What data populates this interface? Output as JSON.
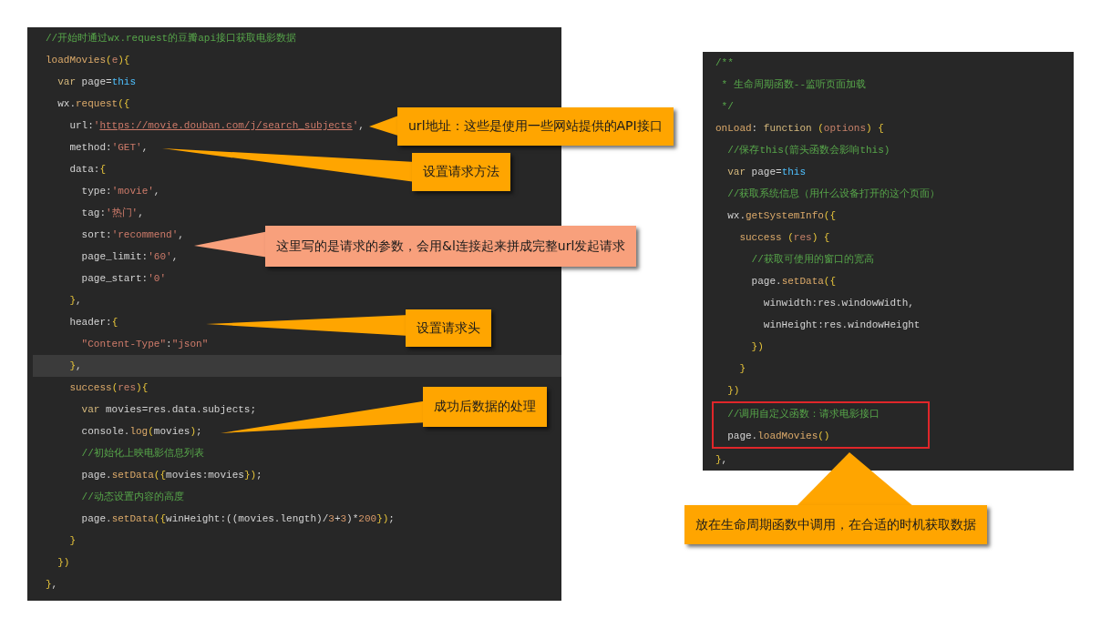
{
  "left_editor": {
    "lines": [
      {
        "current": false,
        "tokens": [
          {
            "kind": "comment",
            "text": "//开始时通过wx.request的豆瓣api接口获取电影数据"
          }
        ]
      },
      {
        "current": false,
        "tokens": [
          {
            "kind": "func",
            "text": "loadMovies"
          },
          {
            "kind": "bracket",
            "text": "("
          },
          {
            "kind": "param",
            "text": "e"
          },
          {
            "kind": "bracket",
            "text": "){"
          }
        ]
      },
      {
        "current": false,
        "tokens": [
          {
            "kind": "keyword",
            "text": "  var"
          },
          {
            "kind": "plain",
            "text": " page="
          },
          {
            "kind": "this",
            "text": "this"
          }
        ]
      },
      {
        "current": false,
        "tokens": [
          {
            "kind": "plain",
            "text": "  wx."
          },
          {
            "kind": "func",
            "text": "request"
          },
          {
            "kind": "bracket",
            "text": "({"
          }
        ]
      },
      {
        "current": false,
        "tokens": [
          {
            "kind": "plain",
            "text": "    url:"
          },
          {
            "kind": "string",
            "text": "'"
          },
          {
            "kind": "url",
            "text": "https://movie.douban.com/j/search_subjects"
          },
          {
            "kind": "string",
            "text": "'"
          },
          {
            "kind": "plain",
            "text": ","
          }
        ]
      },
      {
        "current": false,
        "tokens": [
          {
            "kind": "plain",
            "text": "    method:"
          },
          {
            "kind": "string",
            "text": "'GET'"
          },
          {
            "kind": "plain",
            "text": ","
          }
        ]
      },
      {
        "current": false,
        "tokens": [
          {
            "kind": "plain",
            "text": "    data:"
          },
          {
            "kind": "bracket",
            "text": "{"
          }
        ]
      },
      {
        "current": false,
        "tokens": [
          {
            "kind": "plain",
            "text": "      type:"
          },
          {
            "kind": "string",
            "text": "'movie'"
          },
          {
            "kind": "plain",
            "text": ","
          }
        ]
      },
      {
        "current": false,
        "tokens": [
          {
            "kind": "plain",
            "text": "      tag:"
          },
          {
            "kind": "string",
            "text": "'热门'"
          },
          {
            "kind": "plain",
            "text": ","
          }
        ]
      },
      {
        "current": false,
        "tokens": [
          {
            "kind": "plain",
            "text": "      sort:"
          },
          {
            "kind": "string",
            "text": "'recommend'"
          },
          {
            "kind": "plain",
            "text": ","
          }
        ]
      },
      {
        "current": false,
        "tokens": [
          {
            "kind": "plain",
            "text": "      page_limit:"
          },
          {
            "kind": "string",
            "text": "'60'"
          },
          {
            "kind": "plain",
            "text": ","
          }
        ]
      },
      {
        "current": false,
        "tokens": [
          {
            "kind": "plain",
            "text": "      page_start:"
          },
          {
            "kind": "string",
            "text": "'0'"
          }
        ]
      },
      {
        "current": false,
        "tokens": [
          {
            "kind": "bracket",
            "text": "    }"
          },
          {
            "kind": "plain",
            "text": ","
          }
        ]
      },
      {
        "current": false,
        "tokens": [
          {
            "kind": "plain",
            "text": "    header:"
          },
          {
            "kind": "bracket",
            "text": "{"
          }
        ]
      },
      {
        "current": false,
        "tokens": [
          {
            "kind": "string",
            "text": "      \"Content-Type\""
          },
          {
            "kind": "plain",
            "text": ":"
          },
          {
            "kind": "string",
            "text": "\"json\""
          }
        ]
      },
      {
        "current": true,
        "tokens": [
          {
            "kind": "bracket",
            "text": "    }"
          },
          {
            "kind": "plain",
            "text": ","
          }
        ]
      },
      {
        "current": false,
        "tokens": [
          {
            "kind": "func",
            "text": "    success"
          },
          {
            "kind": "bracket",
            "text": "("
          },
          {
            "kind": "param",
            "text": "res"
          },
          {
            "kind": "bracket",
            "text": "){"
          }
        ]
      },
      {
        "current": false,
        "tokens": [
          {
            "kind": "keyword",
            "text": "      var"
          },
          {
            "kind": "plain",
            "text": " movies=res.data.subjects;"
          }
        ]
      },
      {
        "current": false,
        "tokens": [
          {
            "kind": "plain",
            "text": "      console."
          },
          {
            "kind": "func",
            "text": "log"
          },
          {
            "kind": "bracket",
            "text": "("
          },
          {
            "kind": "plain",
            "text": "movies"
          },
          {
            "kind": "bracket",
            "text": ")"
          },
          {
            "kind": "plain",
            "text": ";"
          }
        ]
      },
      {
        "current": false,
        "tokens": [
          {
            "kind": "comment",
            "text": "      //初始化上映电影信息列表"
          }
        ]
      },
      {
        "current": false,
        "tokens": [
          {
            "kind": "plain",
            "text": "      page."
          },
          {
            "kind": "func",
            "text": "setData"
          },
          {
            "kind": "bracket",
            "text": "({"
          },
          {
            "kind": "plain",
            "text": "movies:movies"
          },
          {
            "kind": "bracket",
            "text": "})"
          },
          {
            "kind": "plain",
            "text": ";"
          }
        ]
      },
      {
        "current": false,
        "tokens": [
          {
            "kind": "comment",
            "text": "      //动态设置内容的高度"
          }
        ]
      },
      {
        "current": false,
        "tokens": [
          {
            "kind": "plain",
            "text": "      page."
          },
          {
            "kind": "func",
            "text": "setData"
          },
          {
            "kind": "bracket",
            "text": "({"
          },
          {
            "kind": "plain",
            "text": "winHeight:((movies.length)/"
          },
          {
            "kind": "number",
            "text": "3"
          },
          {
            "kind": "plain",
            "text": "+"
          },
          {
            "kind": "number",
            "text": "3"
          },
          {
            "kind": "plain",
            "text": ")*"
          },
          {
            "kind": "number",
            "text": "200"
          },
          {
            "kind": "bracket",
            "text": "})"
          },
          {
            "kind": "plain",
            "text": ";"
          }
        ]
      },
      {
        "current": false,
        "tokens": [
          {
            "kind": "bracket",
            "text": "    }"
          }
        ]
      },
      {
        "current": false,
        "tokens": [
          {
            "kind": "bracket",
            "text": "  })"
          }
        ]
      },
      {
        "current": false,
        "tokens": [
          {
            "kind": "bracket",
            "text": "}"
          },
          {
            "kind": "plain",
            "text": ","
          }
        ]
      }
    ]
  },
  "right_editor": {
    "lines_before": [
      {
        "tokens": [
          {
            "kind": "comment",
            "text": "/**"
          }
        ]
      },
      {
        "tokens": [
          {
            "kind": "comment",
            "text": " * 生命周期函数--监听页面加载"
          }
        ]
      },
      {
        "tokens": [
          {
            "kind": "comment",
            "text": " */"
          }
        ]
      },
      {
        "tokens": [
          {
            "kind": "func",
            "text": "onLoad"
          },
          {
            "kind": "plain",
            "text": ": "
          },
          {
            "kind": "keyword",
            "text": "function"
          },
          {
            "kind": "bracket",
            "text": " ("
          },
          {
            "kind": "param",
            "text": "options"
          },
          {
            "kind": "bracket",
            "text": ") {"
          }
        ]
      },
      {
        "tokens": [
          {
            "kind": "comment",
            "text": "  //保存this(箭头函数会影响this)"
          }
        ]
      },
      {
        "tokens": [
          {
            "kind": "keyword",
            "text": "  var"
          },
          {
            "kind": "plain",
            "text": " page="
          },
          {
            "kind": "this",
            "text": "this"
          }
        ]
      },
      {
        "tokens": [
          {
            "kind": "comment",
            "text": "  //获取系统信息（用什么设备打开的这个页面）"
          }
        ]
      },
      {
        "tokens": [
          {
            "kind": "plain",
            "text": "  wx."
          },
          {
            "kind": "func",
            "text": "getSystemInfo"
          },
          {
            "kind": "bracket",
            "text": "({"
          }
        ]
      },
      {
        "tokens": [
          {
            "kind": "func",
            "text": "    success"
          },
          {
            "kind": "bracket",
            "text": " ("
          },
          {
            "kind": "param",
            "text": "res"
          },
          {
            "kind": "bracket",
            "text": ") {"
          }
        ]
      },
      {
        "tokens": [
          {
            "kind": "comment",
            "text": "      //获取可使用的窗口的宽高"
          }
        ]
      },
      {
        "tokens": [
          {
            "kind": "plain",
            "text": "      page."
          },
          {
            "kind": "func",
            "text": "setData"
          },
          {
            "kind": "bracket",
            "text": "({"
          }
        ]
      },
      {
        "tokens": [
          {
            "kind": "plain",
            "text": "        winwidth:res.windowWidth,"
          }
        ]
      },
      {
        "tokens": [
          {
            "kind": "plain",
            "text": "        winHeight:res.windowHeight"
          }
        ]
      },
      {
        "tokens": [
          {
            "kind": "bracket",
            "text": "      })"
          }
        ]
      },
      {
        "tokens": [
          {
            "kind": "bracket",
            "text": "    }"
          }
        ]
      },
      {
        "tokens": [
          {
            "kind": "bracket",
            "text": "  })"
          }
        ]
      }
    ],
    "red_box": {
      "lines": [
        {
          "tokens": [
            {
              "kind": "comment",
              "text": "  //调用自定义函数：请求电影接口"
            }
          ]
        },
        {
          "tokens": [
            {
              "kind": "plain",
              "text": "  page."
            },
            {
              "kind": "func",
              "text": "loadMovies"
            },
            {
              "kind": "bracket",
              "text": "()"
            }
          ]
        }
      ]
    },
    "lines_after": [
      {
        "tokens": [
          {
            "kind": "bracket",
            "text": "}"
          },
          {
            "kind": "plain",
            "text": ","
          }
        ]
      }
    ]
  },
  "callouts": [
    {
      "text": "url地址：这些是使用一些网站提供的API接口",
      "color": "#ffa500"
    },
    {
      "text": "设置请求方法",
      "color": "#ffa500"
    },
    {
      "text": "这里写的是请求的参数，会用&l连接起来拼成完整url发起请求",
      "color": "#f8a07c"
    },
    {
      "text": "设置请求头",
      "color": "#ffa500"
    },
    {
      "text": "成功后数据的处理",
      "color": "#ffa500"
    },
    {
      "text": "放在生命周期函数中调用，在合适的时机获取数据",
      "color": "#ffa500"
    }
  ]
}
